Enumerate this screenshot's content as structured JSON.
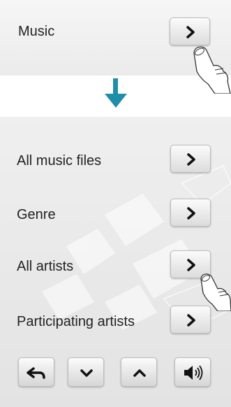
{
  "top": {
    "label": "Music"
  },
  "menu": {
    "items": [
      {
        "label": "All music files"
      },
      {
        "label": "Genre"
      },
      {
        "label": "All artists"
      },
      {
        "label": "Participating artists"
      }
    ]
  },
  "icons": {
    "item_chevron": "chevron-right-icon",
    "down_arrow": "arrow-down-icon",
    "back": "back-arrow-icon",
    "scroll_down": "chevron-down-icon",
    "scroll_up": "chevron-up-icon",
    "volume": "speaker-volume-icon",
    "touch": "hand-pointer-icon"
  },
  "colors": {
    "accent": "#1f8ea8",
    "panel": "#ebebeb",
    "button": "#e6e6e6",
    "icon": "#111111"
  }
}
